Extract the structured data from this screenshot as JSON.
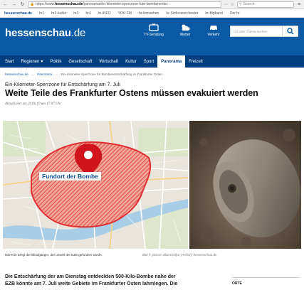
{
  "browser": {
    "url_scheme": "https://www.",
    "url_host": "hessenschau.de",
    "url_path": "/panorama/ein-kilometer-sperrzone-fuer-bombenentsc",
    "search_placeholder": "Search"
  },
  "network_bar": {
    "brand": "hessenschau.de",
    "links": [
      "hr1",
      "hr2-kultur",
      "hr3",
      "hr4",
      "hr-iNFO",
      "YOU FM",
      "hr-fernsehen",
      "hr-Sinfonieorchester",
      "hr-Bigband",
      "Der hr"
    ]
  },
  "header": {
    "logo_bold": "hessenschau",
    "logo_rest": ".de",
    "tv_label": "TV-Sendung",
    "weather_label": "Wetter",
    "traffic_label": "Verkehr",
    "search_placeholder": "Ort oder Thema suchen"
  },
  "nav": {
    "items": [
      {
        "label": "Start",
        "has_dropdown": false
      },
      {
        "label": "Regionen",
        "has_dropdown": true
      },
      {
        "label": "Politik",
        "has_dropdown": false
      },
      {
        "label": "Gesellschaft",
        "has_dropdown": false
      },
      {
        "label": "Wirtschaft",
        "has_dropdown": false
      },
      {
        "label": "Kultur",
        "has_dropdown": false
      },
      {
        "label": "Sport",
        "has_dropdown": false
      },
      {
        "label": "Panorama",
        "has_dropdown": false,
        "active": true
      },
      {
        "label": "Freizeit",
        "has_dropdown": false
      }
    ]
  },
  "breadcrumb": {
    "home": "hessenschau.de",
    "section": "Panorama",
    "current": "Ein-Kilometer-Sperrzone für Bombenentschärfung im Frankfurter Osten"
  },
  "article": {
    "kicker": "Ein-Kilometer-Sperrzone für Entschärfung am 7. Juli",
    "headline": "Weite Teile des Frankfurter Ostens müssen evakuiert werden",
    "dateline": "Aktualisiert am 26.06.19 um 17:07 Uhr",
    "map_label": "Fundort der Bombe",
    "caption": "500-Kilo wiegt der Blindgänger, der unweit der EZB gefunden wurde.",
    "credit": "Bild © picture-alliance/dpa (Archiv), hessenschau.de",
    "lead_line1": "Die Entschärfung der am Dienstag entdeckten 500-Kilo-Bombe nahe der",
    "lead_line2": "EZB könnte am 7. Juli weite Gebiete im Frankfurter Osten lahmlegen. Die",
    "aside_title": "ORTE"
  },
  "colors": {
    "brand_blue": "#0a5aa6",
    "nav_blue": "#003f80",
    "zone_red": "#e0262a",
    "pin_red": "#d0141b"
  }
}
